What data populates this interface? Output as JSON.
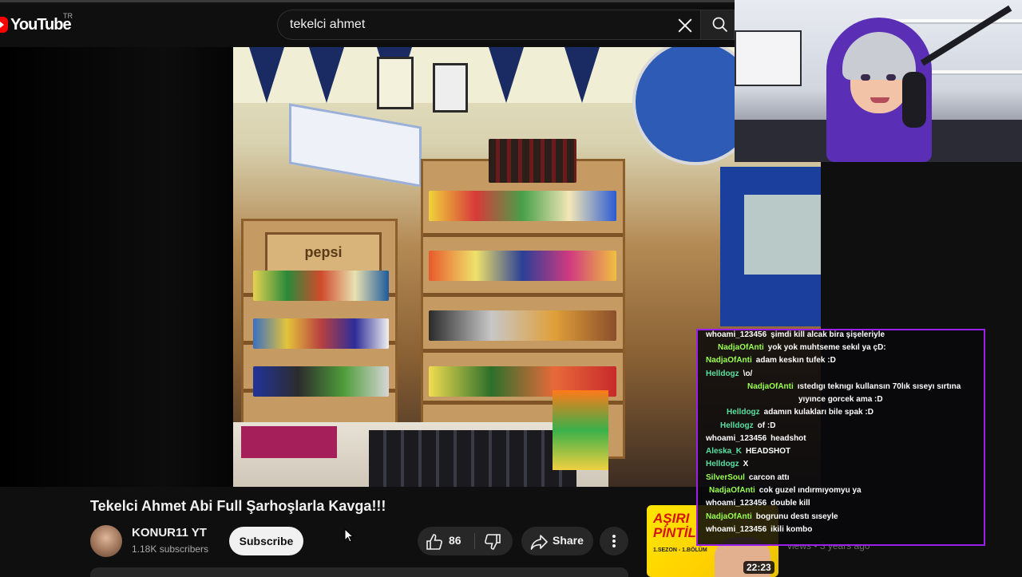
{
  "header": {
    "logo_text": "YouTube",
    "region": "TR",
    "search_value": "tekelci ahmet"
  },
  "video": {
    "title": "Tekelci Ahmet Abi Full Şarhoşlarla Kavga!!!",
    "store_sign": "pepsi",
    "channel": {
      "name": "KONUR11 YT",
      "subscribers": "1.18K subscribers"
    },
    "subscribe_label": "Subscribe",
    "like_count": "86",
    "share_label": "Share"
  },
  "recommended": {
    "thumb_title_line1": "AŞIRI",
    "thumb_title_line2": "PİNTİL",
    "thumb_sub": "1.SEZON - 1.BÖLÜM",
    "duration": "22:23",
    "meta": "views • 3 years ago"
  },
  "chat": {
    "border_color": "#9b1fe8",
    "messages": [
      {
        "user": "whoami_123456",
        "color": "#ffffff",
        "text": "şimdi kill alcak bira şişeleriyle"
      },
      {
        "user": "NadjaOfAnti",
        "color": "#9aff52",
        "text": "yok yok muhtseme sekıl ya çD:"
      },
      {
        "user": "NadjaOfAnti",
        "color": "#9aff52",
        "text": "adam keskın tufek :D"
      },
      {
        "user": "Helldogz",
        "color": "#58e0a0",
        "text": "\\o/"
      },
      {
        "user": "NadjaOfAnti",
        "color": "#9aff52",
        "text": "ıstedıgı teknıgı kullansın 70lık sıseyı sırtına"
      },
      {
        "user": "",
        "color": "#ffffff",
        "text": "yıyınce gorcek ama :D"
      },
      {
        "user": "Helldogz",
        "color": "#58e0a0",
        "text": "adamın kulakları bile spak :D"
      },
      {
        "user": "Helldogz",
        "color": "#58e0a0",
        "text": "of :D"
      },
      {
        "user": "whoami_123456",
        "color": "#ffffff",
        "text": "headshot"
      },
      {
        "user": "Aleska_K",
        "color": "#58e0a0",
        "text": "HEADSHOT"
      },
      {
        "user": "Helldogz",
        "color": "#58e0a0",
        "text": "X"
      },
      {
        "user": "SilverSoul",
        "color": "#9aff52",
        "text": "carcon attı"
      },
      {
        "user": "NadjaOfAnti",
        "color": "#9aff52",
        "text": "cok guzel ındırmıyomyu ya"
      },
      {
        "user": "whoami_123456",
        "color": "#ffffff",
        "text": "double kill"
      },
      {
        "user": "NadjaOfAnti",
        "color": "#9aff52",
        "text": "bogrunu destı sıseyle"
      },
      {
        "user": "whoami_123456",
        "color": "#ffffff",
        "text": "ikili kombo"
      }
    ]
  }
}
